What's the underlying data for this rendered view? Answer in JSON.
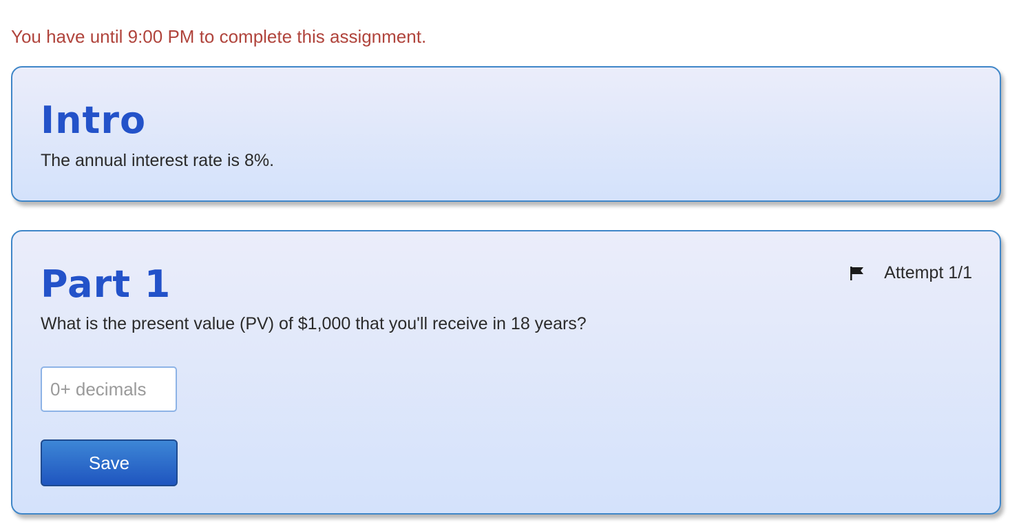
{
  "deadline_text": "You have until 9:00 PM to complete this assignment.",
  "intro": {
    "title": "Intro",
    "text": "The annual interest rate is 8%."
  },
  "part1": {
    "title": "Part 1",
    "attempt_label": "Attempt 1/1",
    "flag_icon": "flag-icon",
    "question": "What is the present value (PV) of $1,000 that you'll receive in 18 years?",
    "input_placeholder": "0+ decimals",
    "input_value": "",
    "save_label": "Save"
  },
  "colors": {
    "deadline": "#b0443c",
    "title": "#2352c9",
    "card_border": "#3f86c8",
    "button": "#1f55bf"
  }
}
